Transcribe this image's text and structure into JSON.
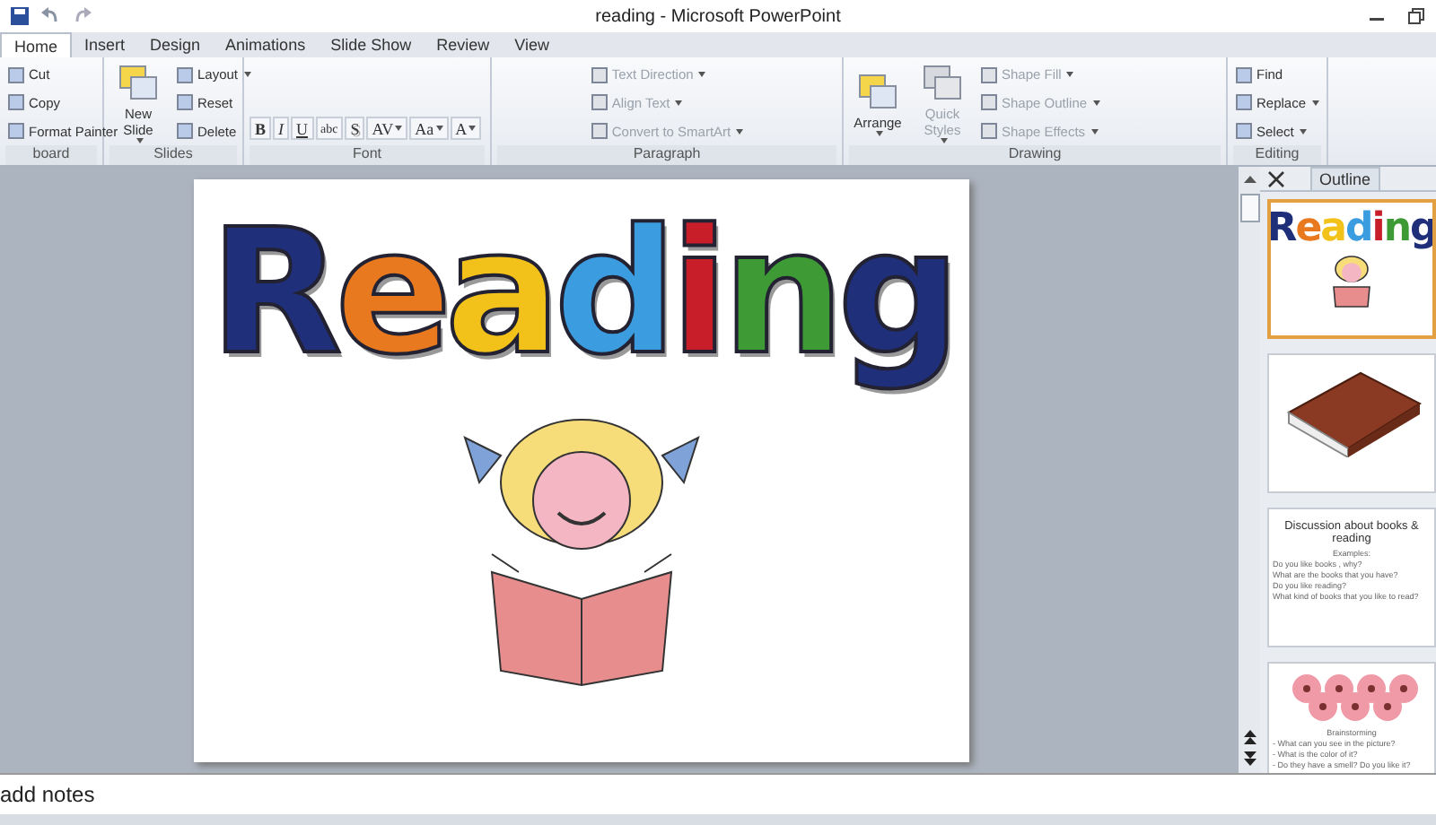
{
  "window": {
    "title": "reading - Microsoft PowerPoint"
  },
  "tabs": [
    {
      "label": "Home",
      "selected": true
    },
    {
      "label": "Insert",
      "selected": false
    },
    {
      "label": "Design",
      "selected": false
    },
    {
      "label": "Animations",
      "selected": false
    },
    {
      "label": "Slide Show",
      "selected": false
    },
    {
      "label": "Review",
      "selected": false
    },
    {
      "label": "View",
      "selected": false
    }
  ],
  "groups": [
    {
      "label": "board",
      "columns": [
        [
          {
            "label": "Cut",
            "kind": "small",
            "disabled": false,
            "dropdown": false
          },
          {
            "label": "Copy",
            "kind": "small",
            "disabled": false,
            "dropdown": false
          },
          {
            "label": "Format Painter",
            "kind": "small",
            "disabled": false,
            "dropdown": false
          }
        ]
      ]
    },
    {
      "label": "Slides",
      "columns": [
        [
          {
            "label": "New Slide",
            "kind": "large",
            "disabled": false,
            "dropdown": true
          }
        ],
        [
          {
            "label": "Layout",
            "kind": "small",
            "disabled": false,
            "dropdown": true
          },
          {
            "label": "Reset",
            "kind": "small",
            "disabled": false,
            "dropdown": false
          },
          {
            "label": "Delete",
            "kind": "small",
            "disabled": false,
            "dropdown": false
          }
        ]
      ]
    },
    {
      "label": "Font",
      "columns": [
        [
          {
            "label": "B",
            "kind": "glyph",
            "disabled": false,
            "dropdown": false
          },
          {
            "label": "I",
            "kind": "glyph",
            "disabled": false,
            "dropdown": false
          },
          {
            "label": "U",
            "kind": "glyph",
            "disabled": false,
            "dropdown": false
          },
          {
            "label": "abc",
            "kind": "glyph",
            "disabled": false,
            "dropdown": false
          },
          {
            "label": "S",
            "kind": "glyph",
            "disabled": false,
            "dropdown": false
          },
          {
            "label": "AV",
            "kind": "glyph",
            "disabled": false,
            "dropdown": true
          },
          {
            "label": "Aa",
            "kind": "glyph",
            "disabled": false,
            "dropdown": true
          },
          {
            "label": "A",
            "kind": "glyph",
            "disabled": false,
            "dropdown": true
          }
        ]
      ]
    },
    {
      "label": "Paragraph",
      "columns": [
        [
          {
            "label": "Text Direction",
            "kind": "small",
            "disabled": true,
            "dropdown": true
          },
          {
            "label": "Align Text",
            "kind": "small",
            "disabled": true,
            "dropdown": true
          },
          {
            "label": "Convert to SmartArt",
            "kind": "small",
            "disabled": true,
            "dropdown": true
          }
        ]
      ]
    },
    {
      "label": "Drawing",
      "columns": [
        [
          {
            "label": "Arrange",
            "kind": "large",
            "disabled": false,
            "dropdown": true
          }
        ],
        [
          {
            "label": "Quick Styles",
            "kind": "large",
            "disabled": true,
            "dropdown": true
          }
        ],
        [
          {
            "label": "Shape Fill",
            "kind": "small",
            "disabled": true,
            "dropdown": true
          },
          {
            "label": "Shape Outline",
            "kind": "small",
            "disabled": true,
            "dropdown": true
          },
          {
            "label": "Shape Effects",
            "kind": "small",
            "disabled": true,
            "dropdown": true
          }
        ]
      ]
    },
    {
      "label": "Editing",
      "columns": [
        [
          {
            "label": "Find",
            "kind": "small",
            "disabled": false,
            "dropdown": false
          },
          {
            "label": "Replace",
            "kind": "small",
            "disabled": false,
            "dropdown": true
          },
          {
            "label": "Select",
            "kind": "small",
            "disabled": false,
            "dropdown": true
          }
        ]
      ]
    }
  ],
  "slide": {
    "title": "Reading"
  },
  "panel": {
    "tab": "Outline"
  },
  "thumbnails": [
    {
      "kind": "title",
      "selected": true,
      "title": "Reading"
    },
    {
      "kind": "picture",
      "selected": false
    },
    {
      "kind": "text",
      "selected": false,
      "title": "Discussion about books & reading",
      "lines": [
        "Examples:",
        "Do you like books , why?",
        "What are the books that you have?",
        "Do you like reading?",
        "What kind of books that you like to read?"
      ]
    },
    {
      "kind": "flowers",
      "selected": false,
      "title": "Brainstorming",
      "lines": [
        "- What can you see in the picture?",
        "- What is the color of it?",
        "- Do they have a smell? Do you like it?"
      ]
    }
  ],
  "notes": {
    "text": "add notes"
  }
}
